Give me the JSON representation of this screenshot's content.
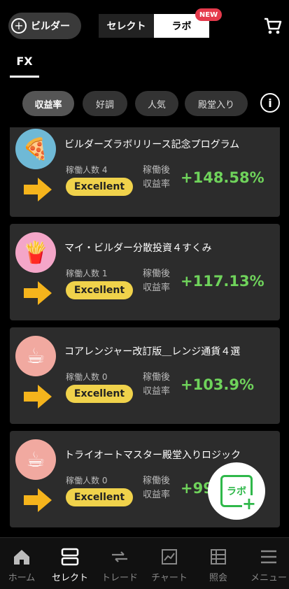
{
  "header": {
    "builder_label": "ビルダー",
    "tab_select": "セレクト",
    "tab_lab": "ラボ",
    "new_badge": "NEW"
  },
  "category_tab": "FX",
  "filters": [
    "収益率",
    "好調",
    "人気",
    "殿堂入り"
  ],
  "active_filter": "収益率",
  "strategies": [
    {
      "title": "ビルダーズラボリリース記念プログラム",
      "people": "稼働人数 4",
      "badge": "Excellent",
      "rate_label_1": "稼働後",
      "rate_label_2": "収益率",
      "rate_value": "+148.58%",
      "avatar": "pizza-avatar",
      "avatar_glyph": "🍕",
      "avatar_bg": "#6fb9d6"
    },
    {
      "title": "マイ・ビルダー分散投資４すくみ",
      "people": "稼働人数 1",
      "badge": "Excellent",
      "rate_label_1": "稼働後",
      "rate_label_2": "収益率",
      "rate_value": "+117.13%",
      "avatar": "fries-avatar",
      "avatar_glyph": "🍟",
      "avatar_bg": "#f4a6c8"
    },
    {
      "title": "コアレンジャー改訂版＿レンジ通貨４選",
      "people": "稼働人数 0",
      "badge": "Excellent",
      "rate_label_1": "稼働後",
      "rate_label_2": "収益率",
      "rate_value": "+103.9%",
      "avatar": "coffee-avatar",
      "avatar_glyph": "☕",
      "avatar_bg": "#f1a9a0"
    },
    {
      "title": "トライオートマスター殿堂入りロジック",
      "people": "稼働人数 0",
      "badge": "Excellent",
      "rate_label_1": "稼働後",
      "rate_label_2": "収益率",
      "rate_value": "+99",
      "avatar": "coffee-avatar",
      "avatar_glyph": "☕",
      "avatar_bg": "#f1a9a0"
    }
  ],
  "fab_label": "ラボ",
  "bottom_nav": [
    {
      "label": "ホーム",
      "icon": "home-icon"
    },
    {
      "label": "セレクト",
      "icon": "select-icon"
    },
    {
      "label": "トレード",
      "icon": "trade-icon"
    },
    {
      "label": "チャート",
      "icon": "chart-icon"
    },
    {
      "label": "照会",
      "icon": "inquiry-icon"
    },
    {
      "label": "メニュー",
      "icon": "menu-icon"
    }
  ],
  "active_nav": "セレクト",
  "colors": {
    "accent_green": "#6fd35b",
    "badge_yellow": "#f0d24b",
    "arrow_yellow": "#f5b41c",
    "new_red": "#e53a4c",
    "lab_green": "#2fb84a"
  }
}
